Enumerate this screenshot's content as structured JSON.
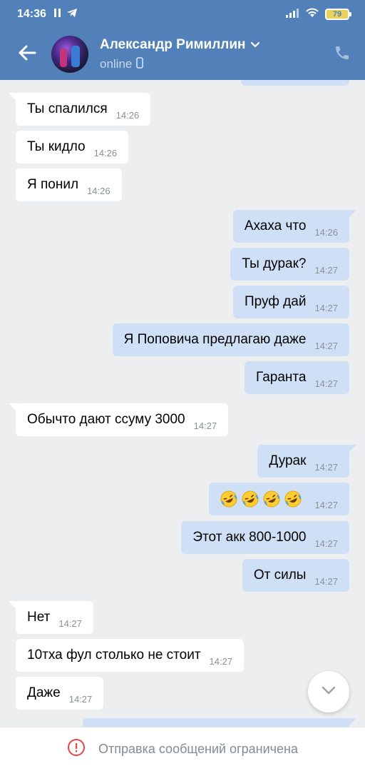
{
  "status_bar": {
    "time": "14:36",
    "battery": "79"
  },
  "header": {
    "contact_name": "Александр Римиллин",
    "contact_status": "online"
  },
  "messages": [
    {
      "text": "Ты спалился",
      "time": "14:26",
      "direction": "in"
    },
    {
      "text": "Ты кидло",
      "time": "14:26",
      "direction": "in"
    },
    {
      "text": "Я понил",
      "time": "14:26",
      "direction": "in"
    },
    {
      "text": "Ахаха что",
      "time": "14:26",
      "direction": "out"
    },
    {
      "text": "Ты дурак?",
      "time": "14:27",
      "direction": "out"
    },
    {
      "text": "Пруф дай",
      "time": "14:27",
      "direction": "out"
    },
    {
      "text": "Я Поповича предлагаю даже",
      "time": "14:27",
      "direction": "out"
    },
    {
      "text": "Гаранта",
      "time": "14:27",
      "direction": "out"
    },
    {
      "text": "Обычто дают ссуму 3000",
      "time": "14:27",
      "direction": "in"
    },
    {
      "text": "Дурак",
      "time": "14:27",
      "direction": "out"
    },
    {
      "text": "",
      "emoji": [
        "rolling-on-floor-laughing",
        "rolling-on-floor-laughing",
        "rolling-on-floor-laughing",
        "rolling-on-floor-laughing"
      ],
      "time": "14:27",
      "direction": "out"
    },
    {
      "text": "Этот акк 800-1000",
      "time": "14:27",
      "direction": "out"
    },
    {
      "text": "От силы",
      "time": "14:27",
      "direction": "out"
    },
    {
      "text": "Нет",
      "time": "14:27",
      "direction": "in"
    },
    {
      "text": "10тха фул столько не стоит",
      "time": "14:27",
      "direction": "in"
    },
    {
      "text": "Даже",
      "time": "14:27",
      "direction": "in"
    }
  ],
  "bottom_bar": {
    "notice": "Отправка сообщений ограничена"
  },
  "colors": {
    "header": "#5181b8",
    "outgoing_bubble": "#cfe0f6",
    "incoming_bubble": "#ffffff",
    "background": "#edeef0",
    "warning": "#e64646"
  },
  "icons": [
    "back-arrow-icon",
    "chevron-down-icon",
    "mobile-icon",
    "phone-icon",
    "chevron-down-icon",
    "exclamation-circle-icon"
  ]
}
